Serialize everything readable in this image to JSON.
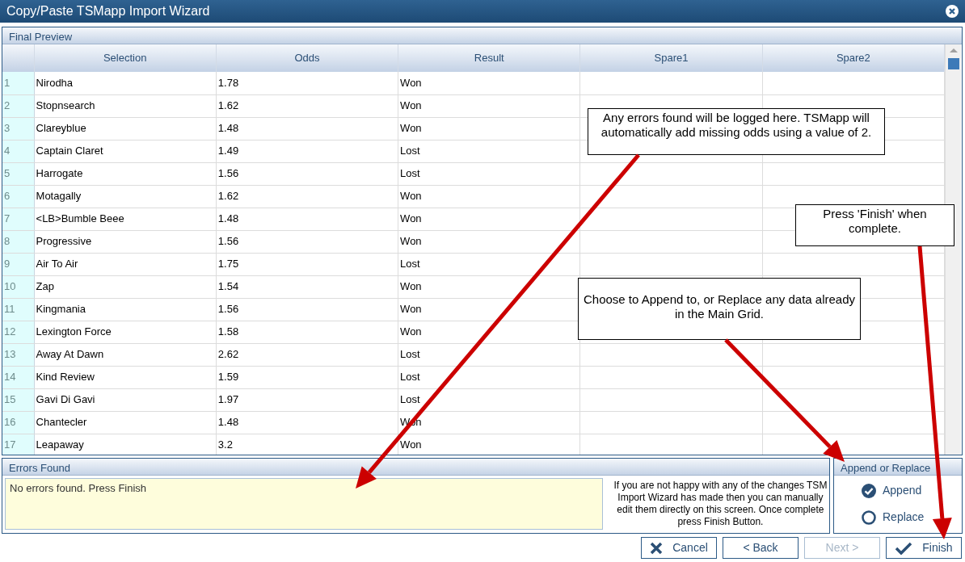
{
  "window": {
    "title": "Copy/Paste TSMapp Import Wizard"
  },
  "final_preview": {
    "title": "Final Preview",
    "columns": [
      "Selection",
      "Odds",
      "Result",
      "Spare1",
      "Spare2"
    ],
    "rows": [
      {
        "number": "1",
        "selection": "Nirodha",
        "odds": "1.78",
        "result": "Won"
      },
      {
        "number": "2",
        "selection": "Stopnsearch",
        "odds": "1.62",
        "result": "Won"
      },
      {
        "number": "3",
        "selection": "Clareyblue",
        "odds": "1.48",
        "result": "Won"
      },
      {
        "number": "4",
        "selection": "Captain Claret",
        "odds": "1.49",
        "result": "Lost"
      },
      {
        "number": "5",
        "selection": "Harrogate",
        "odds": "1.56",
        "result": "Lost"
      },
      {
        "number": "6",
        "selection": "Motagally",
        "odds": "1.62",
        "result": "Won"
      },
      {
        "number": "7",
        "selection": "<LB>Bumble Beee",
        "odds": "1.48",
        "result": "Won"
      },
      {
        "number": "8",
        "selection": "Progressive",
        "odds": "1.56",
        "result": "Won"
      },
      {
        "number": "9",
        "selection": "Air To Air",
        "odds": "1.75",
        "result": "Lost"
      },
      {
        "number": "10",
        "selection": "Zap",
        "odds": "1.54",
        "result": "Won"
      },
      {
        "number": "11",
        "selection": "Kingmania",
        "odds": "1.56",
        "result": "Won"
      },
      {
        "number": "12",
        "selection": "Lexington Force",
        "odds": "1.58",
        "result": "Won"
      },
      {
        "number": "13",
        "selection": "Away At Dawn",
        "odds": "2.62",
        "result": "Lost"
      },
      {
        "number": "14",
        "selection": "Kind Review",
        "odds": "1.59",
        "result": "Lost"
      },
      {
        "number": "15",
        "selection": "Gavi Di Gavi",
        "odds": "1.97",
        "result": "Lost"
      },
      {
        "number": "16",
        "selection": "Chantecler",
        "odds": "1.48",
        "result": "Won"
      },
      {
        "number": "17",
        "selection": "Leapaway",
        "odds": "3.2",
        "result": "Won"
      }
    ]
  },
  "errors_found": {
    "title": "Errors Found",
    "text": "No errors found. Press Finish",
    "help_text": "If you are not happy with any of the changes TSM Import Wizard has made then you can manually edit them directly on this screen. Once complete press Finish Button."
  },
  "append_or_replace": {
    "title": "Append or Replace",
    "options": [
      {
        "label": "Append",
        "selected": true
      },
      {
        "label": "Replace",
        "selected": false
      }
    ]
  },
  "buttons": [
    {
      "kind": "cancel",
      "label": "Cancel",
      "disabled": false
    },
    {
      "kind": "back",
      "label": "< Back",
      "disabled": false
    },
    {
      "kind": "next",
      "label": "Next >",
      "disabled": true
    },
    {
      "kind": "finish",
      "label": "Finish",
      "disabled": false
    }
  ],
  "annotations": [
    {
      "text": "Any errors found will be logged here. TSMapp will automatically add missing odds using a value of 2."
    },
    {
      "text": "Press 'Finish' when complete."
    },
    {
      "text": "Choose to Append to, or Replace any data already in the Main Grid."
    }
  ]
}
